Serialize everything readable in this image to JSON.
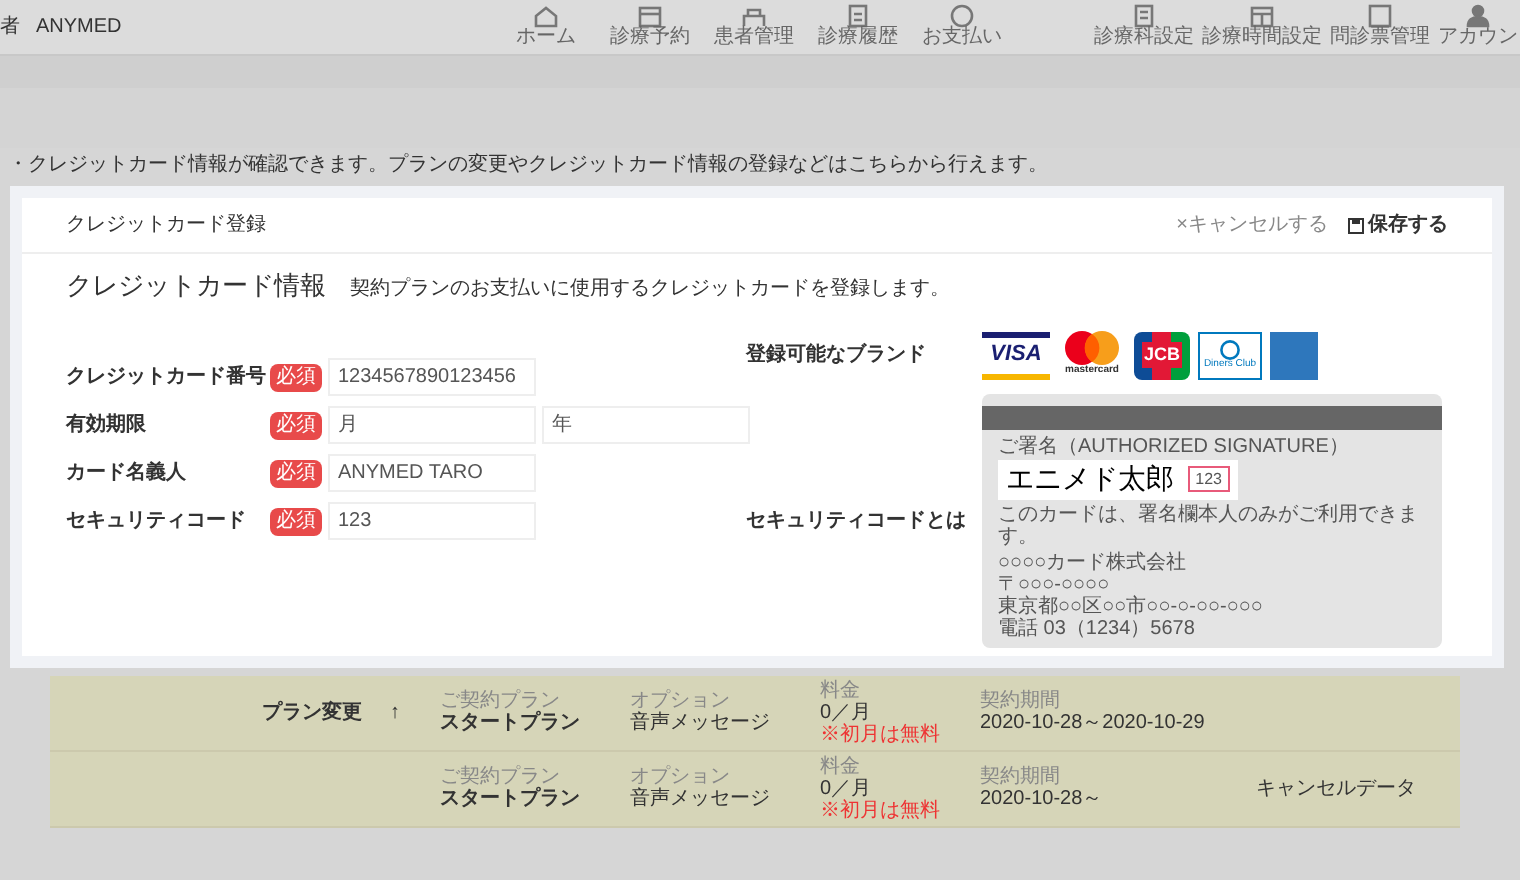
{
  "header": {
    "user_prefix": "者",
    "user_name": "ANYMED",
    "nav_items": [
      {
        "label": "ホーム"
      },
      {
        "label": "診療予約"
      },
      {
        "label": "患者管理"
      },
      {
        "label": "診療履歴"
      },
      {
        "label": "お支払い"
      }
    ],
    "settings_items": [
      {
        "label": "診療科設定"
      },
      {
        "label": "診療時間設定"
      },
      {
        "label": "問診票管理"
      },
      {
        "label": "アカウン"
      }
    ]
  },
  "notice": "・クレジットカード情報が確認できます。プランの変更やクレジットカード情報の登録などはこちらから行えます。",
  "modal": {
    "title": "クレジットカード登録",
    "cancel": "×キャンセルする",
    "save": "保存する",
    "section_title": "クレジットカード情報",
    "section_description": "契約プランのお支払いに使用するクレジットカードを登録します。",
    "fields": [
      {
        "label": "クレジットカード番号",
        "badge": "必須",
        "inputs": [
          {
            "value": "1234567890123456"
          }
        ]
      },
      {
        "label": "有効期限",
        "badge": "必須",
        "inputs": [
          {
            "placeholder": "月"
          },
          {
            "placeholder": "年"
          }
        ]
      },
      {
        "label": "カード名義人",
        "badge": "必須",
        "inputs": [
          {
            "value": "ANYMED TARO"
          }
        ]
      },
      {
        "label": "セキュリティコード",
        "badge": "必須",
        "inputs": [
          {
            "value": "123"
          }
        ]
      }
    ],
    "brands_label": "登録可能なブランド",
    "brands": [
      {
        "kind": "visa",
        "label": "VISA"
      },
      {
        "kind": "mastercard",
        "label": "mastercard"
      },
      {
        "kind": "jcb",
        "label": "JCB"
      },
      {
        "kind": "diners",
        "label": "Diners Club"
      },
      {
        "kind": "amex"
      }
    ],
    "security_label": "セキュリティコードとは",
    "card_sample": {
      "signature_label": "ご署名（AUTHORIZED SIGNATURE）",
      "signature": "エニメド太郎",
      "code": "123",
      "note": "このカードは、署名欄本人のみがご利用できます。",
      "issuer_lines": [
        "○○○○カード株式会社",
        "〒○○○-○○○○",
        "東京都○○区○○市○○-○-○○-○○○",
        "電話 03（1234）5678"
      ]
    }
  },
  "plans": [
    {
      "action": "プラン変更",
      "sort_arrow": "↑",
      "plan_label": "ご契約プラン",
      "plan": "スタートプラン",
      "option_label": "オプション",
      "option": "音声メッセージ",
      "fee_label": "料金",
      "fee": "0／月",
      "fee_note": "※初月は無料",
      "period_label": "契約期間",
      "period": "2020-10-28～2020-10-29"
    },
    {
      "plan_label": "ご契約プラン",
      "plan": "スタートプラン",
      "option_label": "オプション",
      "option": "音声メッセージ",
      "fee_label": "料金",
      "fee": "0／月",
      "fee_note": "※初月は無料",
      "period_label": "契約期間",
      "period": "2020-10-28～",
      "status": "キャンセルデータ"
    }
  ]
}
